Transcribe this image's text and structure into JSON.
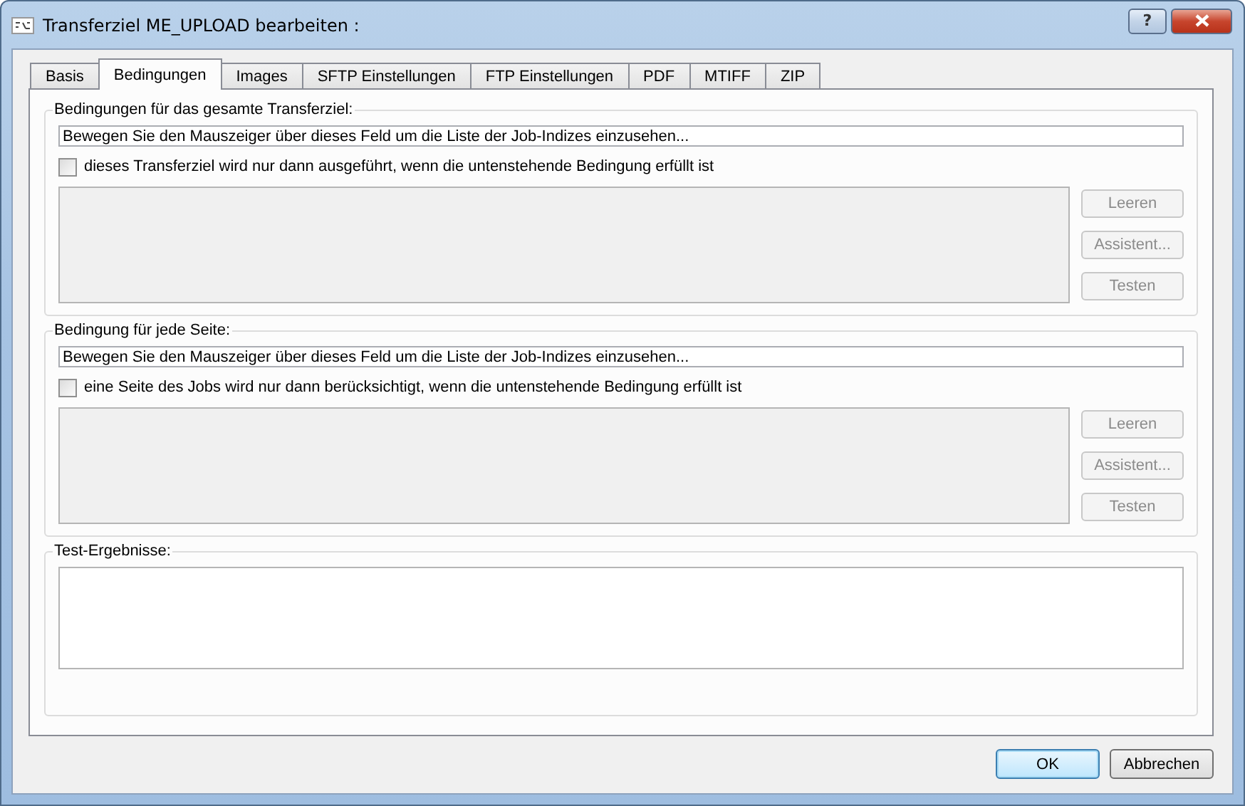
{
  "window": {
    "title": "Transferziel ME_UPLOAD bearbeiten :",
    "help_button": "?"
  },
  "tabs": [
    {
      "label": "Basis",
      "selected": false
    },
    {
      "label": "Bedingungen",
      "selected": true
    },
    {
      "label": "Images",
      "selected": false
    },
    {
      "label": "SFTP Einstellungen",
      "selected": false
    },
    {
      "label": "FTP Einstellungen",
      "selected": false
    },
    {
      "label": "PDF",
      "selected": false
    },
    {
      "label": "MTIFF",
      "selected": false
    },
    {
      "label": "ZIP",
      "selected": false
    }
  ],
  "condition_groups": [
    {
      "title": "Bedingungen für das gesamte Transferziel:",
      "index_field": {
        "value": "Bewegen Sie den Mauszeiger über dieses Feld um die Liste der Job-Indizes einzusehen..."
      },
      "checkbox": {
        "label": "dieses Transferziel wird nur dann ausgeführt, wenn die untenstehende Bedingung erfüllt ist",
        "checked": false
      },
      "condition_editor": {
        "disabled": true
      },
      "buttons": [
        {
          "label": "Leeren",
          "disabled": true
        },
        {
          "label": "Assistent...",
          "disabled": true
        },
        {
          "label": "Testen",
          "disabled": true
        }
      ]
    },
    {
      "title": "Bedingung für jede Seite:",
      "index_field": {
        "value": "Bewegen Sie den Mauszeiger über dieses Feld um die Liste der Job-Indizes einzusehen..."
      },
      "checkbox": {
        "label": "eine Seite des Jobs wird nur dann berücksichtigt, wenn die untenstehende Bedingung erfüllt ist",
        "checked": false
      },
      "condition_editor": {
        "disabled": true
      },
      "buttons": [
        {
          "label": "Leeren",
          "disabled": true
        },
        {
          "label": "Assistent...",
          "disabled": true
        },
        {
          "label": "Testen",
          "disabled": true
        }
      ]
    }
  ],
  "test_results": {
    "title": "Test-Ergebnisse:"
  },
  "footer_buttons": [
    {
      "label": "OK",
      "default": true
    },
    {
      "label": "Abbrechen",
      "default": false
    }
  ]
}
